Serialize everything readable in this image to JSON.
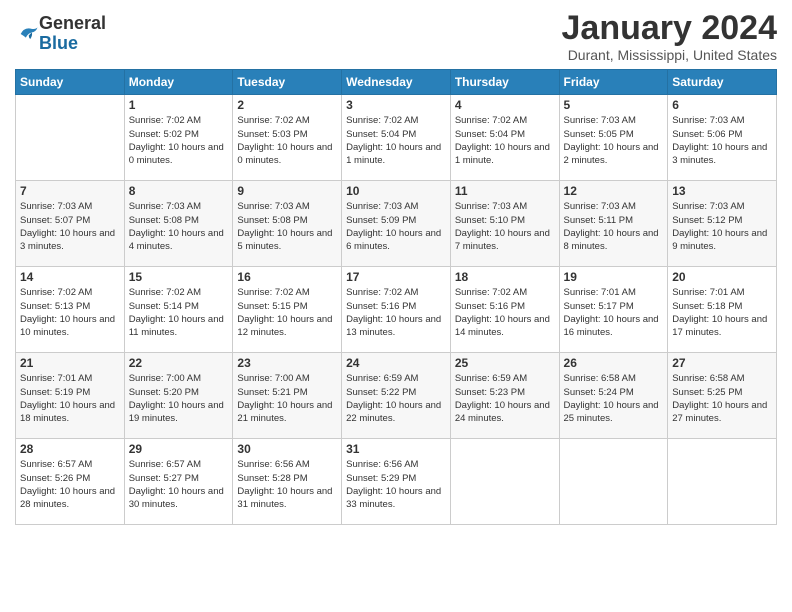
{
  "logo": {
    "general": "General",
    "blue": "Blue"
  },
  "header": {
    "title": "January 2024",
    "location": "Durant, Mississippi, United States"
  },
  "weekdays": [
    "Sunday",
    "Monday",
    "Tuesday",
    "Wednesday",
    "Thursday",
    "Friday",
    "Saturday"
  ],
  "weeks": [
    [
      null,
      {
        "day": "1",
        "sunrise": "Sunrise: 7:02 AM",
        "sunset": "Sunset: 5:02 PM",
        "daylight": "Daylight: 10 hours and 0 minutes."
      },
      {
        "day": "2",
        "sunrise": "Sunrise: 7:02 AM",
        "sunset": "Sunset: 5:03 PM",
        "daylight": "Daylight: 10 hours and 0 minutes."
      },
      {
        "day": "3",
        "sunrise": "Sunrise: 7:02 AM",
        "sunset": "Sunset: 5:04 PM",
        "daylight": "Daylight: 10 hours and 1 minute."
      },
      {
        "day": "4",
        "sunrise": "Sunrise: 7:02 AM",
        "sunset": "Sunset: 5:04 PM",
        "daylight": "Daylight: 10 hours and 1 minute."
      },
      {
        "day": "5",
        "sunrise": "Sunrise: 7:03 AM",
        "sunset": "Sunset: 5:05 PM",
        "daylight": "Daylight: 10 hours and 2 minutes."
      },
      {
        "day": "6",
        "sunrise": "Sunrise: 7:03 AM",
        "sunset": "Sunset: 5:06 PM",
        "daylight": "Daylight: 10 hours and 3 minutes."
      }
    ],
    [
      {
        "day": "7",
        "sunrise": "Sunrise: 7:03 AM",
        "sunset": "Sunset: 5:07 PM",
        "daylight": "Daylight: 10 hours and 3 minutes."
      },
      {
        "day": "8",
        "sunrise": "Sunrise: 7:03 AM",
        "sunset": "Sunset: 5:08 PM",
        "daylight": "Daylight: 10 hours and 4 minutes."
      },
      {
        "day": "9",
        "sunrise": "Sunrise: 7:03 AM",
        "sunset": "Sunset: 5:08 PM",
        "daylight": "Daylight: 10 hours and 5 minutes."
      },
      {
        "day": "10",
        "sunrise": "Sunrise: 7:03 AM",
        "sunset": "Sunset: 5:09 PM",
        "daylight": "Daylight: 10 hours and 6 minutes."
      },
      {
        "day": "11",
        "sunrise": "Sunrise: 7:03 AM",
        "sunset": "Sunset: 5:10 PM",
        "daylight": "Daylight: 10 hours and 7 minutes."
      },
      {
        "day": "12",
        "sunrise": "Sunrise: 7:03 AM",
        "sunset": "Sunset: 5:11 PM",
        "daylight": "Daylight: 10 hours and 8 minutes."
      },
      {
        "day": "13",
        "sunrise": "Sunrise: 7:03 AM",
        "sunset": "Sunset: 5:12 PM",
        "daylight": "Daylight: 10 hours and 9 minutes."
      }
    ],
    [
      {
        "day": "14",
        "sunrise": "Sunrise: 7:02 AM",
        "sunset": "Sunset: 5:13 PM",
        "daylight": "Daylight: 10 hours and 10 minutes."
      },
      {
        "day": "15",
        "sunrise": "Sunrise: 7:02 AM",
        "sunset": "Sunset: 5:14 PM",
        "daylight": "Daylight: 10 hours and 11 minutes."
      },
      {
        "day": "16",
        "sunrise": "Sunrise: 7:02 AM",
        "sunset": "Sunset: 5:15 PM",
        "daylight": "Daylight: 10 hours and 12 minutes."
      },
      {
        "day": "17",
        "sunrise": "Sunrise: 7:02 AM",
        "sunset": "Sunset: 5:16 PM",
        "daylight": "Daylight: 10 hours and 13 minutes."
      },
      {
        "day": "18",
        "sunrise": "Sunrise: 7:02 AM",
        "sunset": "Sunset: 5:16 PM",
        "daylight": "Daylight: 10 hours and 14 minutes."
      },
      {
        "day": "19",
        "sunrise": "Sunrise: 7:01 AM",
        "sunset": "Sunset: 5:17 PM",
        "daylight": "Daylight: 10 hours and 16 minutes."
      },
      {
        "day": "20",
        "sunrise": "Sunrise: 7:01 AM",
        "sunset": "Sunset: 5:18 PM",
        "daylight": "Daylight: 10 hours and 17 minutes."
      }
    ],
    [
      {
        "day": "21",
        "sunrise": "Sunrise: 7:01 AM",
        "sunset": "Sunset: 5:19 PM",
        "daylight": "Daylight: 10 hours and 18 minutes."
      },
      {
        "day": "22",
        "sunrise": "Sunrise: 7:00 AM",
        "sunset": "Sunset: 5:20 PM",
        "daylight": "Daylight: 10 hours and 19 minutes."
      },
      {
        "day": "23",
        "sunrise": "Sunrise: 7:00 AM",
        "sunset": "Sunset: 5:21 PM",
        "daylight": "Daylight: 10 hours and 21 minutes."
      },
      {
        "day": "24",
        "sunrise": "Sunrise: 6:59 AM",
        "sunset": "Sunset: 5:22 PM",
        "daylight": "Daylight: 10 hours and 22 minutes."
      },
      {
        "day": "25",
        "sunrise": "Sunrise: 6:59 AM",
        "sunset": "Sunset: 5:23 PM",
        "daylight": "Daylight: 10 hours and 24 minutes."
      },
      {
        "day": "26",
        "sunrise": "Sunrise: 6:58 AM",
        "sunset": "Sunset: 5:24 PM",
        "daylight": "Daylight: 10 hours and 25 minutes."
      },
      {
        "day": "27",
        "sunrise": "Sunrise: 6:58 AM",
        "sunset": "Sunset: 5:25 PM",
        "daylight": "Daylight: 10 hours and 27 minutes."
      }
    ],
    [
      {
        "day": "28",
        "sunrise": "Sunrise: 6:57 AM",
        "sunset": "Sunset: 5:26 PM",
        "daylight": "Daylight: 10 hours and 28 minutes."
      },
      {
        "day": "29",
        "sunrise": "Sunrise: 6:57 AM",
        "sunset": "Sunset: 5:27 PM",
        "daylight": "Daylight: 10 hours and 30 minutes."
      },
      {
        "day": "30",
        "sunrise": "Sunrise: 6:56 AM",
        "sunset": "Sunset: 5:28 PM",
        "daylight": "Daylight: 10 hours and 31 minutes."
      },
      {
        "day": "31",
        "sunrise": "Sunrise: 6:56 AM",
        "sunset": "Sunset: 5:29 PM",
        "daylight": "Daylight: 10 hours and 33 minutes."
      },
      null,
      null,
      null
    ]
  ]
}
